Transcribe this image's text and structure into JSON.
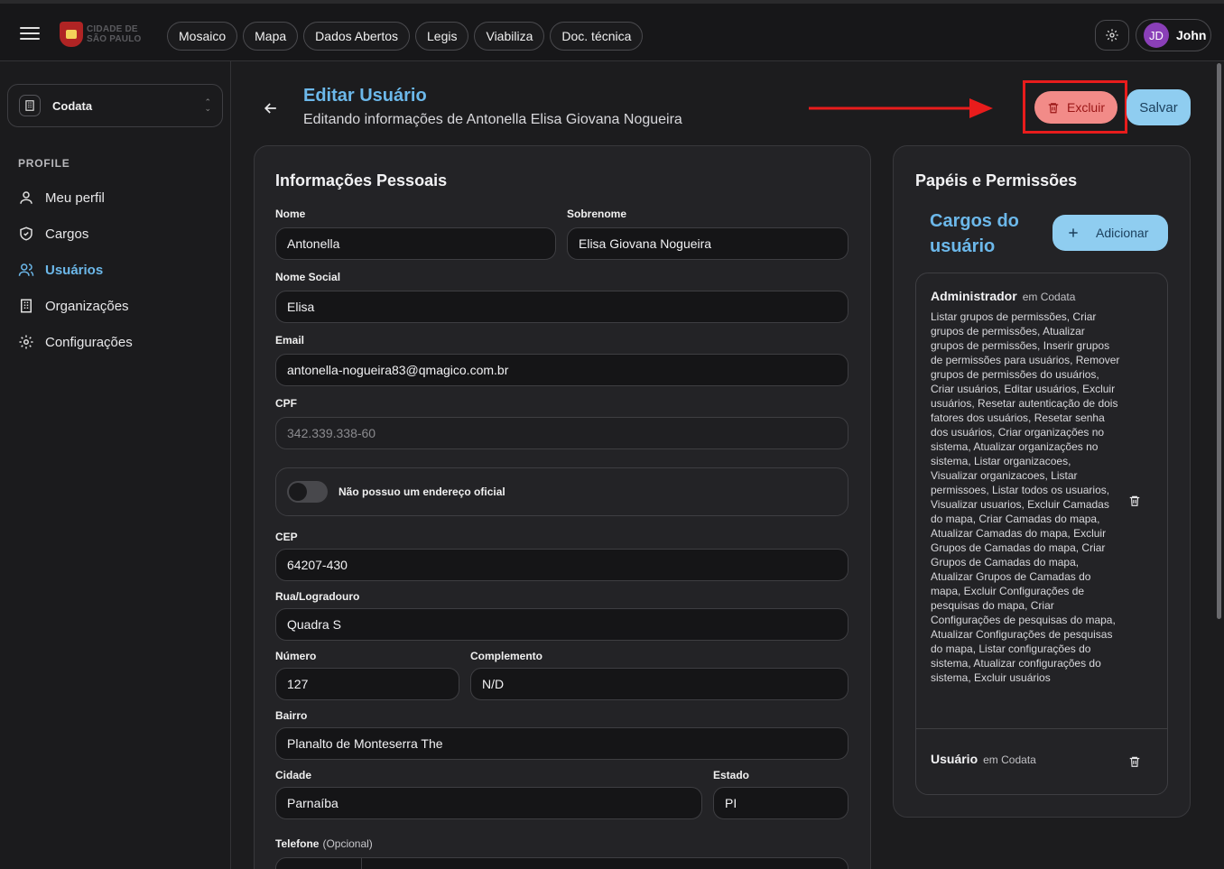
{
  "topbar": {
    "logo_text": "CIDADE DE SÃO PAULO",
    "nav": [
      "Mosaico",
      "Mapa",
      "Dados Abertos",
      "Legis",
      "Viabiliza",
      "Doc. técnica"
    ],
    "user_initials": "JD",
    "user_name": "John"
  },
  "sidebar": {
    "org": "Codata",
    "section": "PROFILE",
    "items": [
      {
        "label": "Meu perfil",
        "icon": "user-icon"
      },
      {
        "label": "Cargos",
        "icon": "shield-icon"
      },
      {
        "label": "Usuários",
        "icon": "users-icon",
        "active": true
      },
      {
        "label": "Organizações",
        "icon": "building-icon"
      },
      {
        "label": "Configurações",
        "icon": "gear-icon"
      }
    ]
  },
  "header": {
    "title": "Editar Usuário",
    "subtitle": "Editando informações de Antonella Elisa Giovana Nogueira",
    "delete_label": "Excluir",
    "save_label": "Salvar"
  },
  "personal": {
    "title": "Informações Pessoais",
    "nome_label": "Nome",
    "nome": "Antonella",
    "sobrenome_label": "Sobrenome",
    "sobrenome": "Elisa Giovana Nogueira",
    "nome_social_label": "Nome Social",
    "nome_social": "Elisa",
    "email_label": "Email",
    "email": "antonella-nogueira83@qmagico.com.br",
    "cpf_label": "CPF",
    "cpf": "342.339.338-60",
    "toggle_label": "Não possuo um endereço oficial",
    "cep_label": "CEP",
    "cep": "64207-430",
    "rua_label": "Rua/Logradouro",
    "rua": "Quadra S",
    "numero_label": "Número",
    "numero": "127",
    "complemento_label": "Complemento",
    "complemento": "N/D",
    "bairro_label": "Bairro",
    "bairro": "Planalto de Monteserra The",
    "cidade_label": "Cidade",
    "cidade": "Parnaíba",
    "estado_label": "Estado",
    "estado": "PI",
    "telefone_label": "Telefone",
    "telefone_opt": "(Opcional)"
  },
  "roles": {
    "title": "Papéis e Permissões",
    "subtitle": "Cargos do usuário",
    "add_label": "Adicionar",
    "items": [
      {
        "name": "Administrador",
        "org": "em Codata",
        "permissions": "Listar grupos de permissões, Criar grupos de permissões, Atualizar grupos de permissões, Inserir grupos de permissões para usuários, Remover grupos de permissões do usuários, Criar usuários, Editar usuários, Excluir usuários, Resetar autenticação de dois fatores dos usuários, Resetar senha dos usuários, Criar organizações no sistema, Atualizar organizações no sistema, Listar organizacoes, Visualizar organizacoes, Listar permissoes, Listar todos os usuarios, Visualizar usuarios, Excluir Camadas do mapa, Criar Camadas do mapa, Atualizar Camadas do mapa, Excluir Grupos de Camadas do mapa, Criar Grupos de Camadas do mapa, Atualizar Grupos de Camadas do mapa, Excluir Configurações de pesquisas do mapa, Criar Configurações de pesquisas do mapa, Atualizar Configurações de pesquisas do mapa, Listar configurações do sistema, Atualizar configurações do sistema, Excluir usuários"
      },
      {
        "name": "Usuário",
        "org": "em Codata"
      }
    ]
  },
  "colors": {
    "accent": "#6cb8ea",
    "danger": "#f28b88",
    "highlight": "#e81c1c"
  }
}
